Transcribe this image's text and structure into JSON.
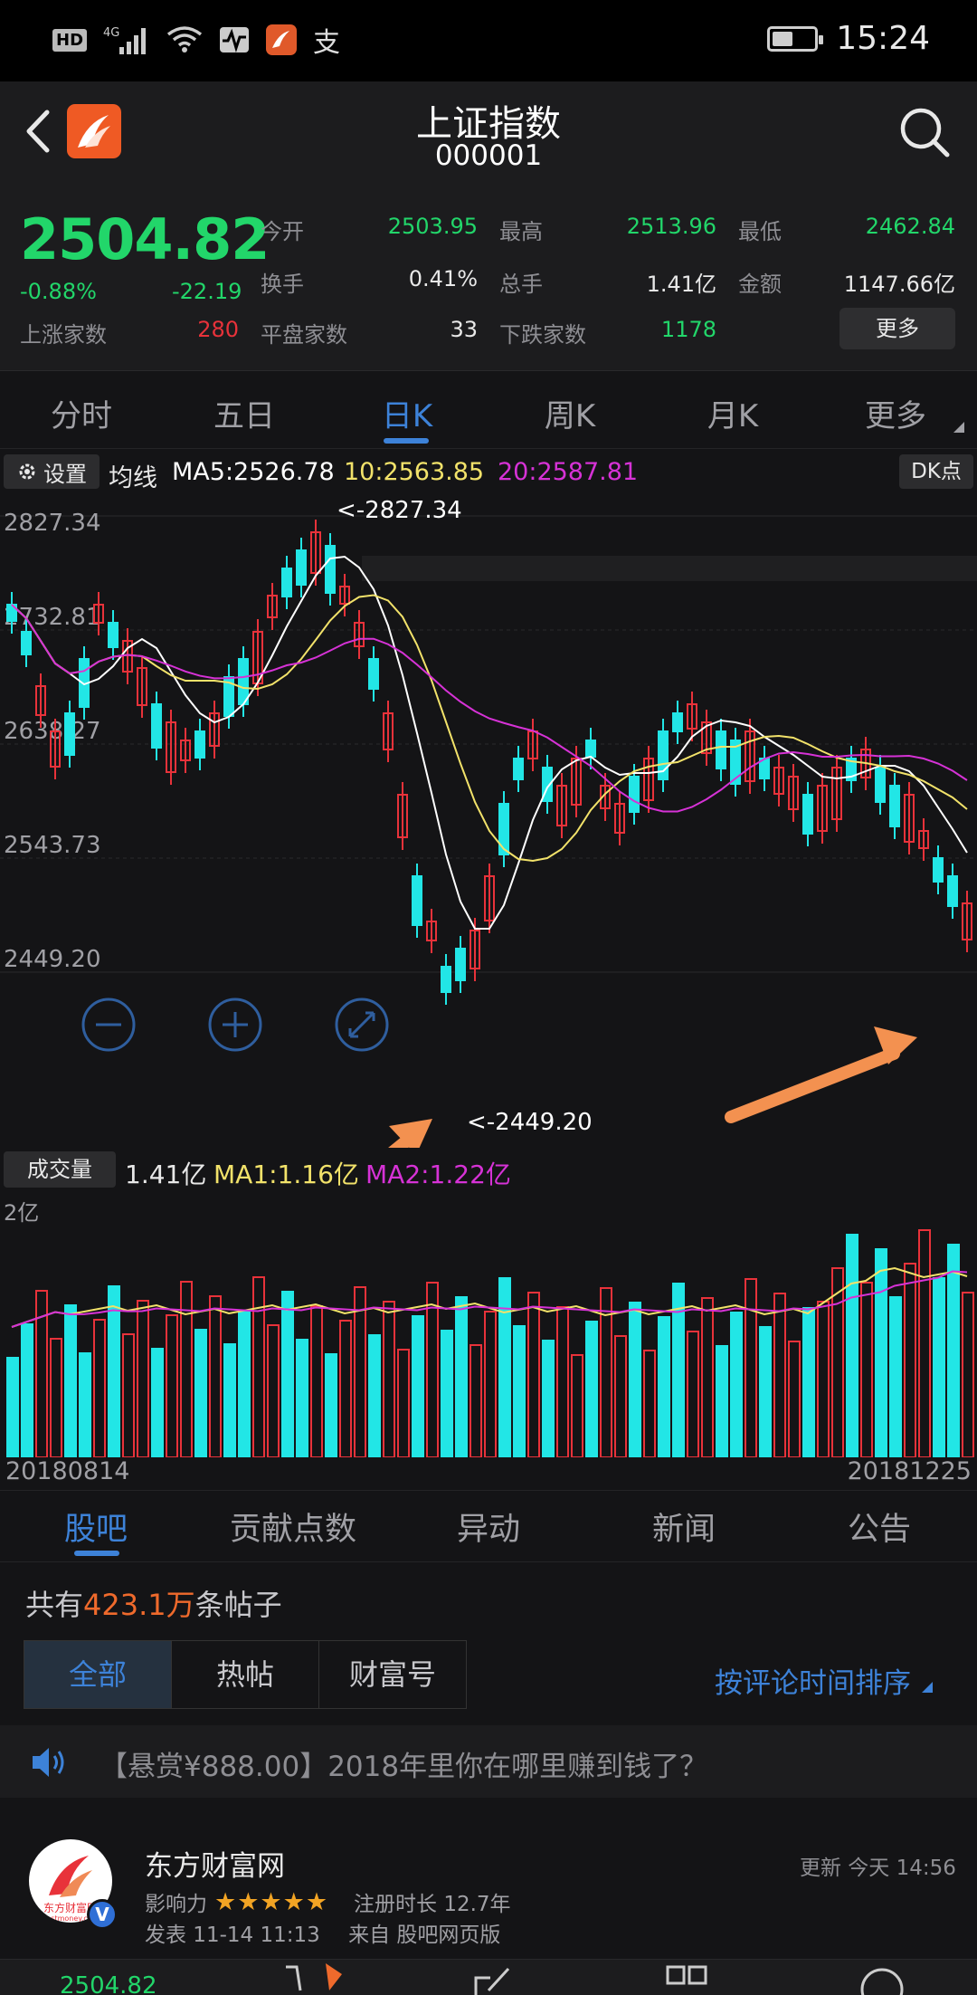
{
  "status_bar": {
    "icons": [
      "hd-icon",
      "4g-signal-icon",
      "wifi-icon",
      "activity-icon",
      "app-icon",
      "alipay-icon"
    ],
    "hd": "HD",
    "net": "4G",
    "alipay": "支",
    "battery_level": 0.5,
    "time": "15:24"
  },
  "header": {
    "title": "上证指数",
    "code": "000001"
  },
  "quote": {
    "price": "2504.82",
    "change_pct": "-0.88%",
    "change": "-22.19",
    "fields": {
      "open_label": "今开",
      "open": "2503.95",
      "high_label": "最高",
      "high": "2513.96",
      "low_label": "最低",
      "low": "2462.84",
      "turnover_label": "换手",
      "turnover": "0.41%",
      "volume_label": "总手",
      "volume": "1.41亿",
      "amount_label": "金额",
      "amount": "1147.66亿",
      "up_label": "上涨家数",
      "up": "280",
      "flat_label": "平盘家数",
      "flat": "33",
      "down_label": "下跌家数",
      "down": "1178"
    },
    "more": "更多"
  },
  "chart_tabs": [
    "分时",
    "五日",
    "日K",
    "周K",
    "月K",
    "更多"
  ],
  "ma_bar": {
    "settings": "设置",
    "label": "均线",
    "ma5": "MA5:2526.78",
    "ma10": "10:2563.85",
    "ma20": "20:2587.81",
    "dk": "DK点"
  },
  "colors": {
    "up": "#e8323a",
    "down": "#22e6e6",
    "ma5": "#ffffff",
    "ma10": "#f2e26a",
    "ma20": "#d632d6",
    "accent": "#3d82d8",
    "price_green": "#22d66a"
  },
  "kline": {
    "y_labels": [
      "2827.34",
      "2732.81",
      "2638.27",
      "2543.73",
      "2449.20"
    ],
    "max_label": "<-2827.34",
    "min_label": "<-2449.20",
    "controls": [
      "zoom-out-icon",
      "zoom-in-icon",
      "expand-icon"
    ]
  },
  "volume_bar": {
    "label": "成交量",
    "value": "1.41亿",
    "ma1": "MA1:1.16亿",
    "ma2": "MA2:1.22亿",
    "axis": "2亿"
  },
  "dates": {
    "start": "20180814",
    "end": "20181225"
  },
  "sub_tabs": [
    "股吧",
    "贡献点数",
    "异动",
    "新闻",
    "公告"
  ],
  "posts_count": {
    "prefix": "共有",
    "number": "423.1万",
    "suffix": "条帖子"
  },
  "filters": [
    "全部",
    "热帖",
    "财富号"
  ],
  "sort": "按评论时间排序",
  "notice": "【悬赏¥888.00】2018年里你在哪里赚到钱了？",
  "post": {
    "author": "东方财富网",
    "avatar_text": "东方财富网",
    "avatar_sub": "eastmoney.com",
    "updated": "更新 今天 14:56",
    "influence_label": "影响力",
    "stars": "★★★★★",
    "reg_label": "注册时长 12.7年",
    "published": "发表 11-14 11:13",
    "source": "来自 股吧网页版",
    "verified": "V"
  },
  "bottom_bar": {
    "price": "2504.82"
  }
}
